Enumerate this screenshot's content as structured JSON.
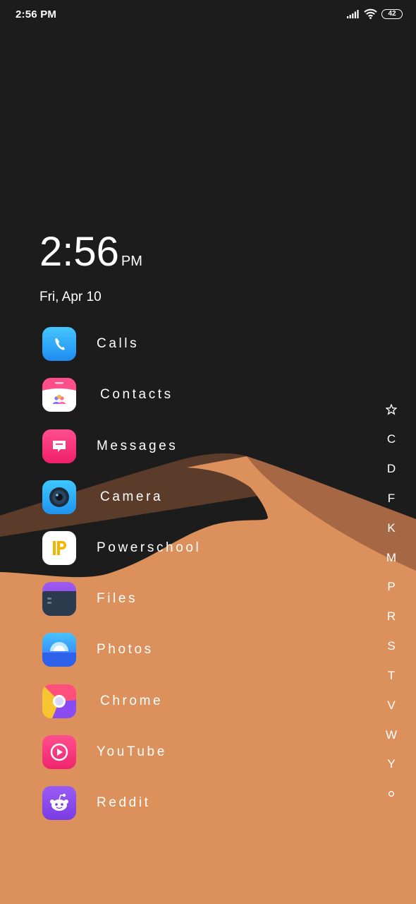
{
  "status_bar": {
    "time": "2:56 PM",
    "battery_level": "42",
    "icons": [
      "signal-icon",
      "wifi-icon",
      "battery-icon"
    ]
  },
  "clock": {
    "time": "2:56",
    "ampm": "PM",
    "date": "Fri, Apr 10"
  },
  "apps": [
    {
      "label": "Calls",
      "icon": "phone-icon"
    },
    {
      "label": "Contacts",
      "icon": "contacts-icon"
    },
    {
      "label": "Messages",
      "icon": "message-icon"
    },
    {
      "label": "Camera",
      "icon": "camera-icon"
    },
    {
      "label": "Powerschool",
      "icon": "powerschool-icon"
    },
    {
      "label": "Files",
      "icon": "files-icon"
    },
    {
      "label": "Photos",
      "icon": "photos-icon"
    },
    {
      "label": "Chrome",
      "icon": "chrome-icon"
    },
    {
      "label": "YouTube",
      "icon": "youtube-icon"
    },
    {
      "label": "Reddit",
      "icon": "reddit-icon"
    }
  ],
  "alpha_index": {
    "favorites_icon": "star-icon",
    "letters": [
      "C",
      "D",
      "F",
      "K",
      "M",
      "P",
      "R",
      "S",
      "T",
      "V",
      "W",
      "Y"
    ],
    "more_icon": "circle-icon"
  },
  "colors": {
    "background_dark": "#1c1c1c",
    "sand": "#dc915c",
    "sand_shadow": "#a96a45",
    "ridge_dark": "#5a3a28"
  }
}
